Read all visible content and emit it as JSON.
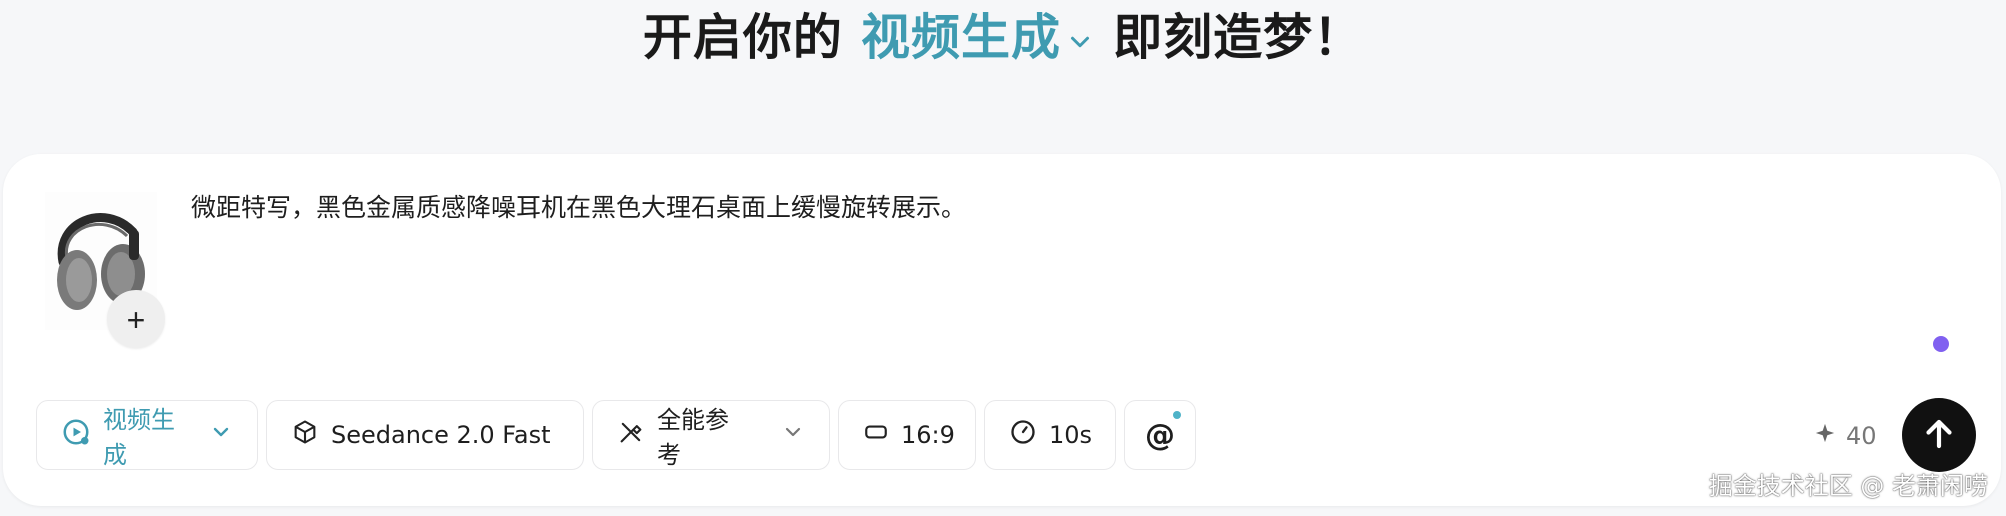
{
  "header": {
    "prefix": "开启你的",
    "mode_label": "视频生成",
    "suffix": "即刻造梦！"
  },
  "composer": {
    "prompt_text": "微距特写，黑色金属质感降噪耳机在黑色大理石桌面上缓慢旋转展示。",
    "add_label": "+",
    "toolbar": {
      "mode_label": "视频生成",
      "model_label": "Seedance 2.0 Fast",
      "reference_label": "全能参考",
      "ratio_label": "16:9",
      "duration_label": "10s",
      "mention_label": "@"
    },
    "credits": "40"
  },
  "watermark": "掘金技术社区 @ 老萧闲唠",
  "colors": {
    "accent": "#3f9bb1",
    "indicator_dot": "#8060f0",
    "send_button": "#111111"
  },
  "icons": [
    "chevron-down-icon",
    "video-play-icon",
    "cube-icon",
    "magic-pen-icon",
    "aspect-ratio-icon",
    "timer-icon",
    "at-icon",
    "sparkle-icon",
    "arrow-up-icon",
    "plus-icon"
  ]
}
